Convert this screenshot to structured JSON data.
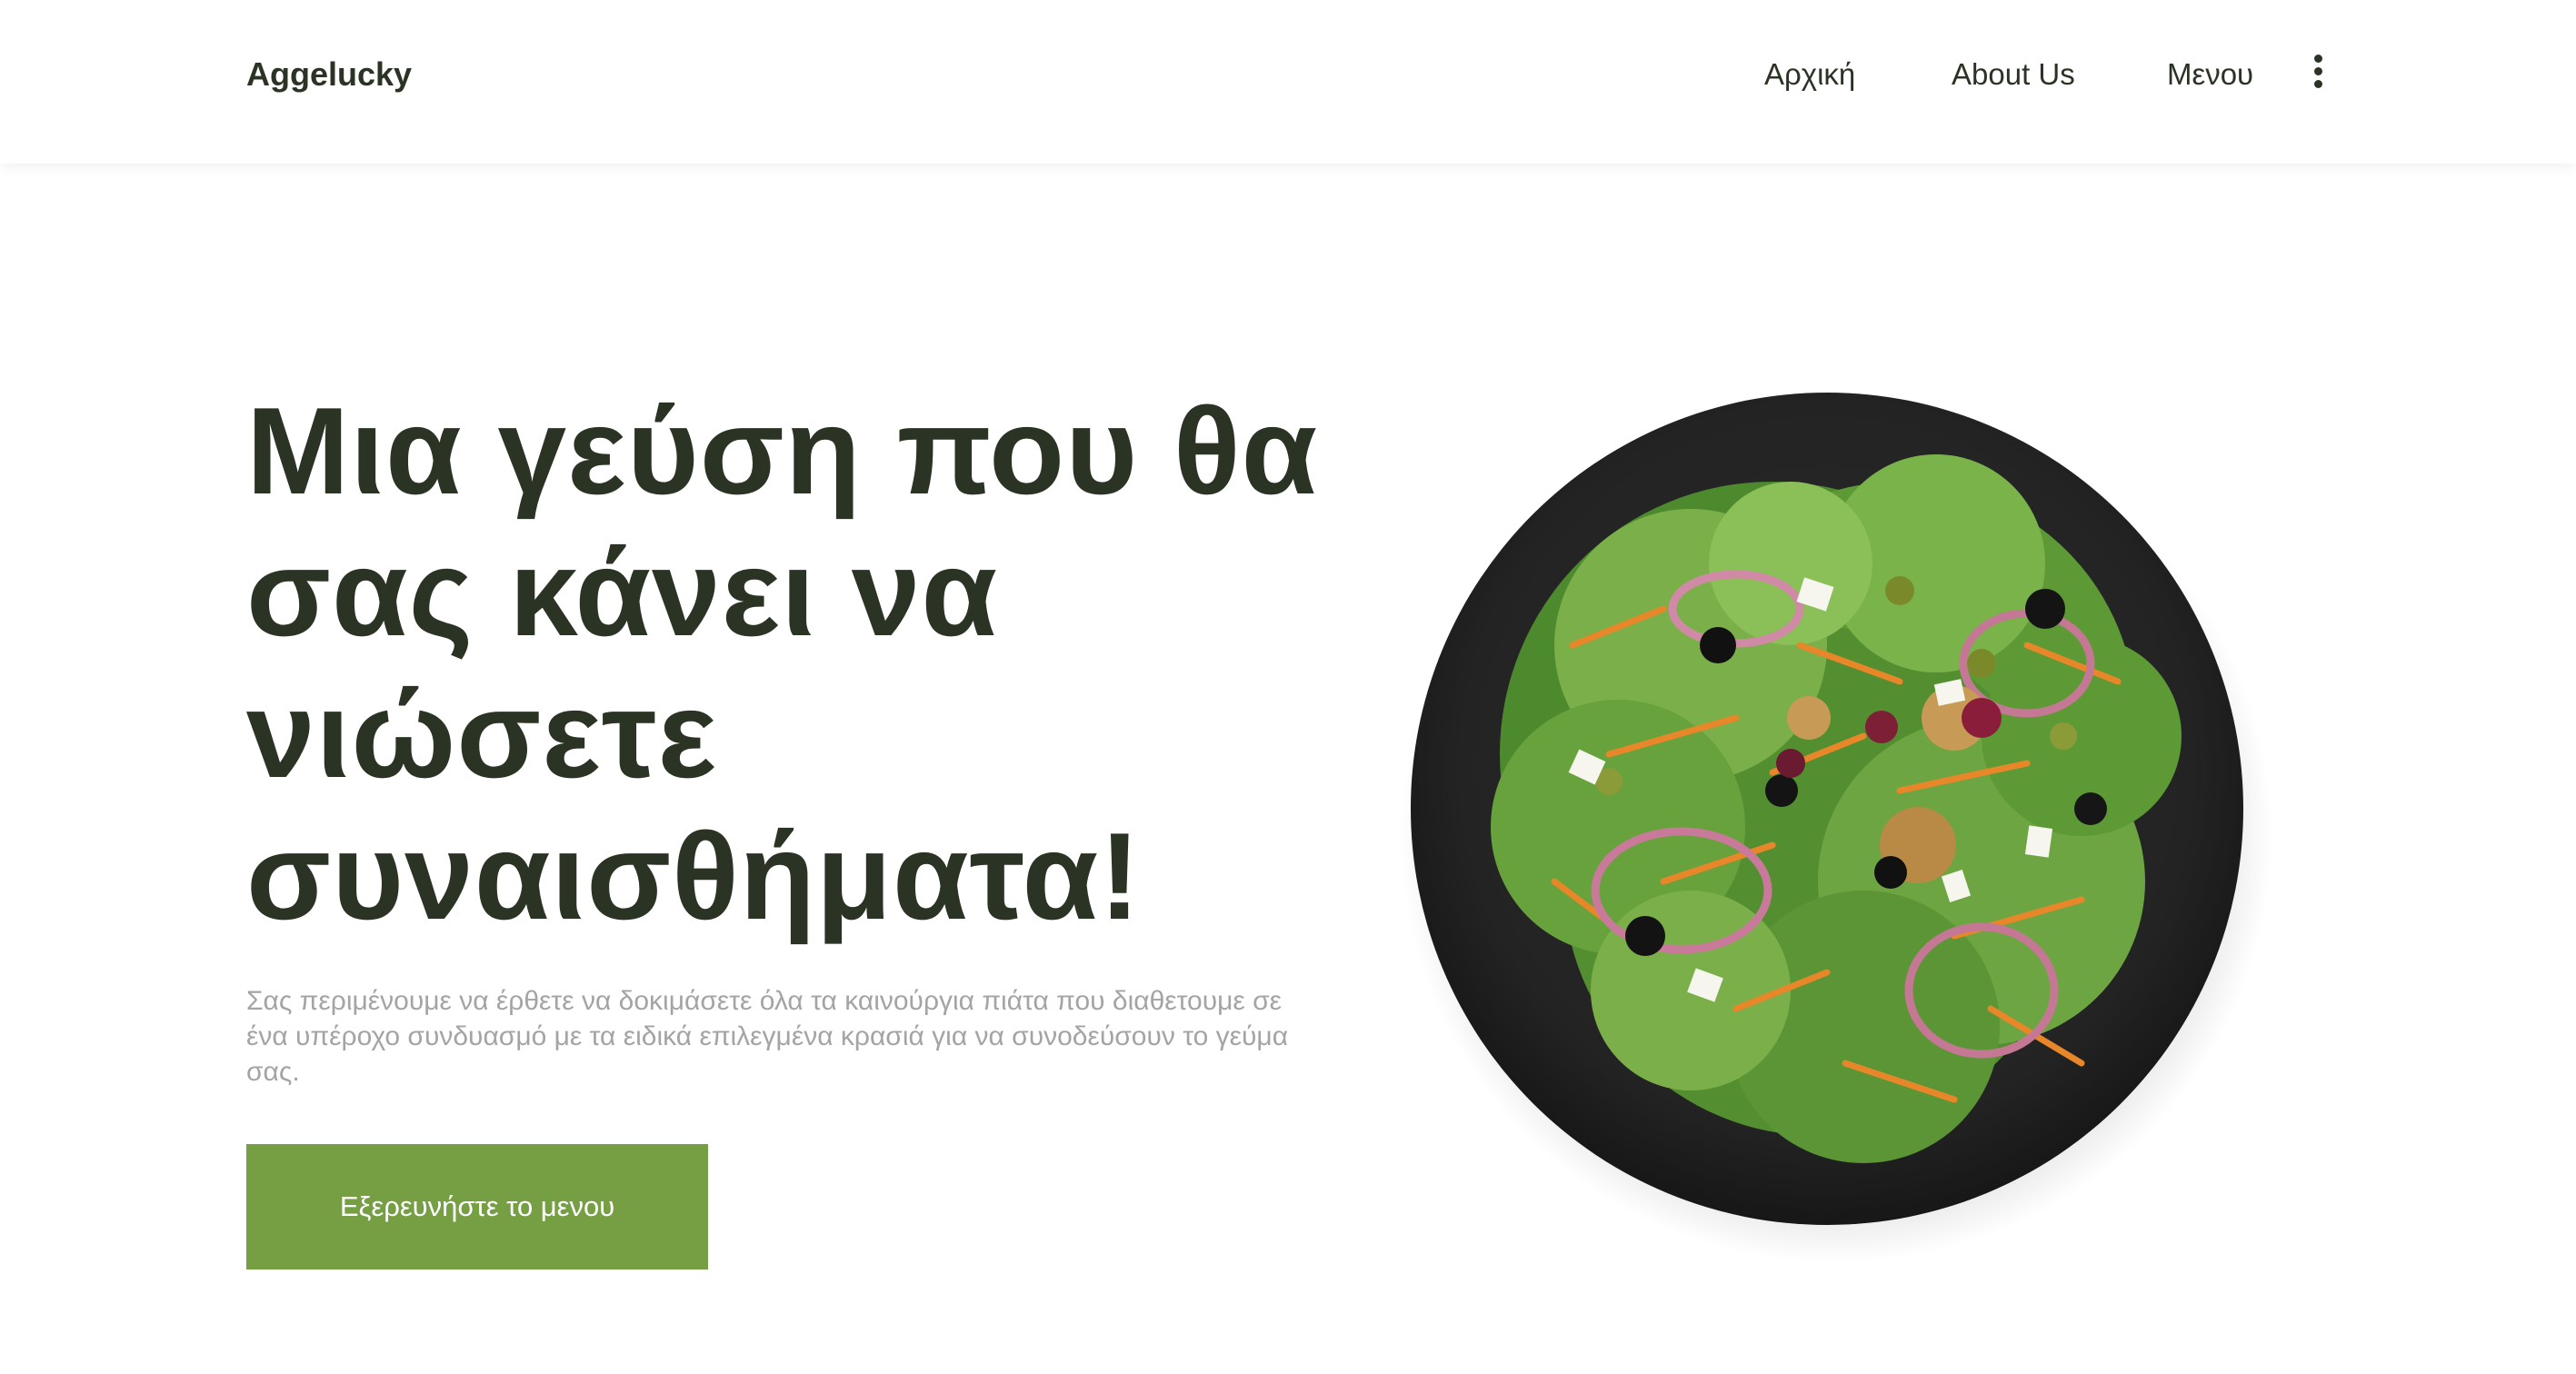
{
  "header": {
    "brand": "Aggelucky",
    "nav": [
      "Αρχική",
      "About Us",
      "Μενου"
    ],
    "more_icon": "vertical-dots-icon"
  },
  "hero": {
    "title": "Μια γεύση που θα σας κάνει να νιώσετε συναισθήματα!",
    "description": "Σας περιμένουμε να έρθετε να δοκιμάσετε όλα τα καινούργια πιάτα που διαθετουμε σε ένα υπέροχο συνδυασμό με τα ειδικά επιλεγμένα κρασιά για να συνοδεύσουν το γεύμα σας.",
    "cta_label": "Εξερευνήστε το μενου"
  },
  "colors": {
    "primary_text": "#2b3424",
    "muted_text": "#a4a4a4",
    "accent": "#769f43",
    "plate": "#252525"
  }
}
